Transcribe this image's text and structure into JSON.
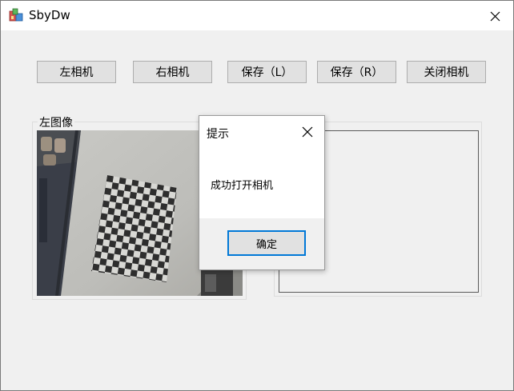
{
  "window": {
    "title": "SbyDw",
    "icon": "app-icon"
  },
  "toolbar": {
    "left_camera": "左相机",
    "right_camera": "右相机",
    "save_left": "保存（L）",
    "save_right": "保存（R）",
    "close_camera": "关闭相机"
  },
  "left_panel": {
    "label": "左图像"
  },
  "dialog": {
    "title": "提示",
    "message": "成功打开相机",
    "ok_label": "确定"
  },
  "colors": {
    "window_bg": "#f0f0f0",
    "button_bg": "#e1e1e1",
    "focus_accent": "#0078d7"
  }
}
